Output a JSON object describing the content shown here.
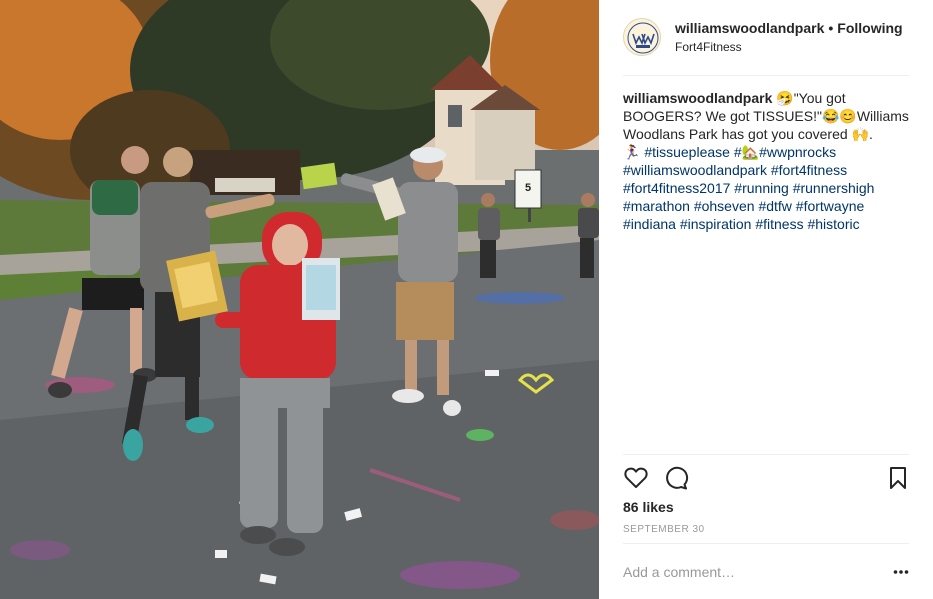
{
  "post": {
    "username": "williamswoodlandpark",
    "separator": "•",
    "follow_label": "Following",
    "location": "Fort4Fitness"
  },
  "caption": {
    "username": "williamswoodlandpark",
    "text_1": "🤧\"You got BOOGERS? We got TISSUES!\"😂😊Williams Woodlans Park has got you covered 🙌.",
    "text_2": "🏃‍♀️",
    "tag_1": "#tissueplease",
    "text_3": "#🏡",
    "tag_2": "#wwpnrocks",
    "tags_rest": [
      "#williamswoodlandpark",
      "#fort4fitness",
      "#fort4fitness2017",
      "#running",
      "#runnershigh",
      "#marathon",
      "#ohseven",
      "#dtfw",
      "#fortwayne",
      "#indiana",
      "#inspiration",
      "#fitness",
      "#historic"
    ]
  },
  "stats": {
    "likes": "86 likes",
    "date": "SEPTEMBER 30"
  },
  "comment": {
    "placeholder": "Add a comment…"
  },
  "photo": {
    "street_sign": "5"
  },
  "icons": {
    "like": "heart-icon",
    "comment": "comment-icon",
    "save": "bookmark-icon",
    "more": "more-options-icon"
  },
  "colors": {
    "text": "#262626",
    "hashtag": "#003569",
    "muted": "#999999",
    "divider": "#efefef"
  }
}
